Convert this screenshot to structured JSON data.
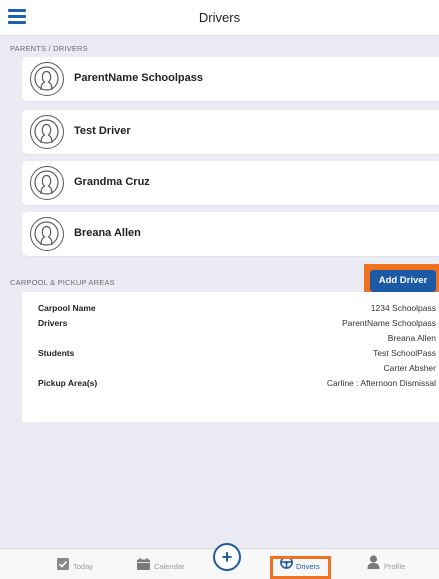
{
  "header": {
    "title": "Drivers"
  },
  "parents_section": {
    "label": "PARENTS / DRIVERS",
    "drivers": [
      {
        "name": "ParentName Schoolpass"
      },
      {
        "name": "Test Driver"
      },
      {
        "name": "Grandma Cruz"
      },
      {
        "name": "Breana Allen"
      }
    ]
  },
  "add_driver_label": "Add Driver",
  "carpool_section": {
    "label": "CARPOOL & PICKUP AREAS",
    "carpool_name_label": "Carpool Name",
    "carpool_name_value": "1234 Schoolpass",
    "drivers_label": "Drivers",
    "drivers_values": [
      "ParentName Schoolpass",
      "Breana Allen"
    ],
    "students_label": "Students",
    "students_values": [
      "Test SchoolPass",
      "Carter Absher"
    ],
    "pickup_label": "Pickup Area(s)",
    "pickup_value": "Carline : Afternoon Dismissal"
  },
  "tabbar": {
    "today": "Today",
    "calendar": "Calendar",
    "add_symbol": "+",
    "drivers": "Drivers",
    "profile": "Profile"
  },
  "colors": {
    "primary": "#1c5aa6",
    "highlight": "#f0711e",
    "background": "#ebebf4"
  }
}
